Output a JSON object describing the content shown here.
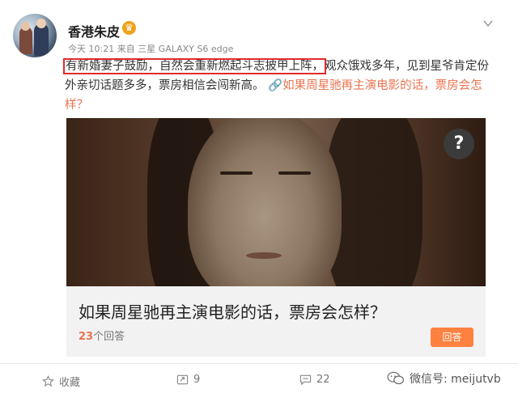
{
  "header": {
    "username": "香港朱皮",
    "verified_badge": "♛",
    "meta": "今天 10:21 来自 三星 GALAXY S6 edge"
  },
  "post": {
    "highlighted": "有新婚妻子鼓励，自然会重新燃起斗志披甲上阵，",
    "text": "观众饿戏多年，见到星爷肯定份外亲切话题多多，票房相信会闯新高。",
    "link_icon": "🔗",
    "link_text": "如果周星驰再主演电影的话，票房会怎样？"
  },
  "card": {
    "help_glyph": "?",
    "title": "如果周星驰再主演电影的话，票房会怎样？",
    "answer_count": "23",
    "answer_suffix": "个回答",
    "answer_button": "回答"
  },
  "actions": {
    "like_label": "收藏",
    "repost_count": "9",
    "comment_count": "22"
  },
  "watermark": {
    "text": "微信号: meijutvb"
  },
  "colors": {
    "accent_orange": "#eb7350",
    "highlight_box": "#e02b2b",
    "answer_button_bg": "#ff8140"
  }
}
